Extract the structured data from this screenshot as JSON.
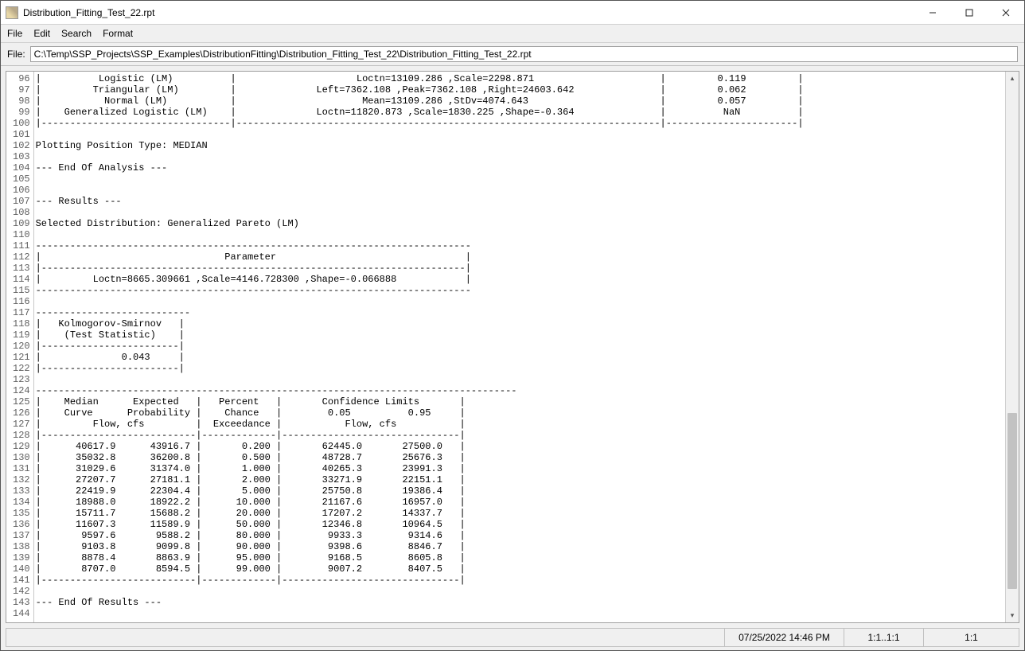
{
  "window": {
    "title": "Distribution_Fitting_Test_22.rpt"
  },
  "menubar": {
    "file": "File",
    "edit": "Edit",
    "search": "Search",
    "format": "Format"
  },
  "filebar": {
    "label": "File:",
    "path": "C:\\Temp\\SSP_Projects\\SSP_Examples\\DistributionFitting\\Distribution_Fitting_Test_22\\Distribution_Fitting_Test_22.rpt"
  },
  "editor": {
    "first_line_no": 96,
    "lines": [
      "|          Logistic (LM)          |                     Loctn=13109.286 ,Scale=2298.871                      |         0.119         |",
      "|         Triangular (LM)         |              Left=7362.108 ,Peak=7362.108 ,Right=24603.642               |         0.062         |",
      "|           Normal (LM)           |                      Mean=13109.286 ,StDv=4074.643                       |         0.057         |",
      "|    Generalized Logistic (LM)    |              Loctn=11820.873 ,Scale=1830.225 ,Shape=-0.364               |          NaN          |",
      "|---------------------------------|--------------------------------------------------------------------------|-----------------------|",
      "",
      "Plotting Position Type: MEDIAN",
      "",
      "--- End Of Analysis ---",
      "",
      "",
      "--- Results ---",
      "",
      "Selected Distribution: Generalized Pareto (LM)",
      "",
      "----------------------------------------------------------------------------",
      "|                                Parameter                                 |",
      "|--------------------------------------------------------------------------|",
      "|         Loctn=8665.309661 ,Scale=4146.728300 ,Shape=-0.066888            |",
      "----------------------------------------------------------------------------",
      "",
      "---------------------------",
      "|   Kolmogorov-Smirnov   |",
      "|    (Test Statistic)    |",
      "|------------------------|",
      "|              0.043     |",
      "|------------------------|",
      "",
      "------------------------------------------------------------------------------------",
      "|    Median      Expected   |   Percent   |       Confidence Limits       |",
      "|    Curve      Probability |    Chance   |        0.05          0.95     |",
      "|         Flow, cfs         |  Exceedance |           Flow, cfs           |",
      "|---------------------------|-------------|-------------------------------|",
      "|      40617.9      43916.7 |       0.200 |       62445.0       27500.0   |",
      "|      35032.8      36200.8 |       0.500 |       48728.7       25676.3   |",
      "|      31029.6      31374.0 |       1.000 |       40265.3       23991.3   |",
      "|      27207.7      27181.1 |       2.000 |       33271.9       22151.1   |",
      "|      22419.9      22304.4 |       5.000 |       25750.8       19386.4   |",
      "|      18988.0      18922.2 |      10.000 |       21167.6       16957.0   |",
      "|      15711.7      15688.2 |      20.000 |       17207.2       14337.7   |",
      "|      11607.3      11589.9 |      50.000 |       12346.8       10964.5   |",
      "|       9597.6       9588.2 |      80.000 |        9933.3        9314.6   |",
      "|       9103.8       9099.8 |      90.000 |        9398.6        8846.7   |",
      "|       8878.4       8863.9 |      95.000 |        9168.5        8605.8   |",
      "|       8707.0       8594.5 |      99.000 |        9007.2        8407.5   |",
      "|---------------------------|-------------|-------------------------------|",
      "",
      "--- End Of Results ---",
      ""
    ]
  },
  "statusbar": {
    "datetime": "07/25/2022 14:46 PM",
    "position": "1:1..1:1",
    "zoom": "1:1"
  },
  "report_structured": {
    "plotting_position_type": "MEDIAN",
    "selected_distribution": "Generalized Pareto (LM)",
    "distributions_tail": [
      {
        "name": "Logistic (LM)",
        "params": "Loctn=13109.286 ,Scale=2298.871",
        "ks": 0.119
      },
      {
        "name": "Triangular (LM)",
        "params": "Left=7362.108 ,Peak=7362.108 ,Right=24603.642",
        "ks": 0.062
      },
      {
        "name": "Normal (LM)",
        "params": "Mean=13109.286 ,StDv=4074.643",
        "ks": 0.057
      },
      {
        "name": "Generalized Logistic (LM)",
        "params": "Loctn=11820.873 ,Scale=1830.225 ,Shape=-0.364",
        "ks": "NaN"
      }
    ],
    "selected_parameters": {
      "Loctn": 8665.309661,
      "Scale": 4146.7283,
      "Shape": -0.066888
    },
    "ks_test_statistic": 0.043,
    "frequency_table": {
      "columns": [
        "Median Curve Flow, cfs",
        "Expected Probability Flow, cfs",
        "Percent Chance Exceedance",
        "Confidence Limit 0.05 Flow, cfs",
        "Confidence Limit 0.95 Flow, cfs"
      ],
      "rows": [
        [
          40617.9,
          43916.7,
          0.2,
          62445.0,
          27500.0
        ],
        [
          35032.8,
          36200.8,
          0.5,
          48728.7,
          25676.3
        ],
        [
          31029.6,
          31374.0,
          1.0,
          40265.3,
          23991.3
        ],
        [
          27207.7,
          27181.1,
          2.0,
          33271.9,
          22151.1
        ],
        [
          22419.9,
          22304.4,
          5.0,
          25750.8,
          19386.4
        ],
        [
          18988.0,
          18922.2,
          10.0,
          21167.6,
          16957.0
        ],
        [
          15711.7,
          15688.2,
          20.0,
          17207.2,
          14337.7
        ],
        [
          11607.3,
          11589.9,
          50.0,
          12346.8,
          10964.5
        ],
        [
          9597.6,
          9588.2,
          80.0,
          9933.3,
          9314.6
        ],
        [
          9103.8,
          9099.8,
          90.0,
          9398.6,
          8846.7
        ],
        [
          8878.4,
          8863.9,
          95.0,
          9168.5,
          8605.8
        ],
        [
          8707.0,
          8594.5,
          99.0,
          9007.2,
          8407.5
        ]
      ]
    }
  }
}
